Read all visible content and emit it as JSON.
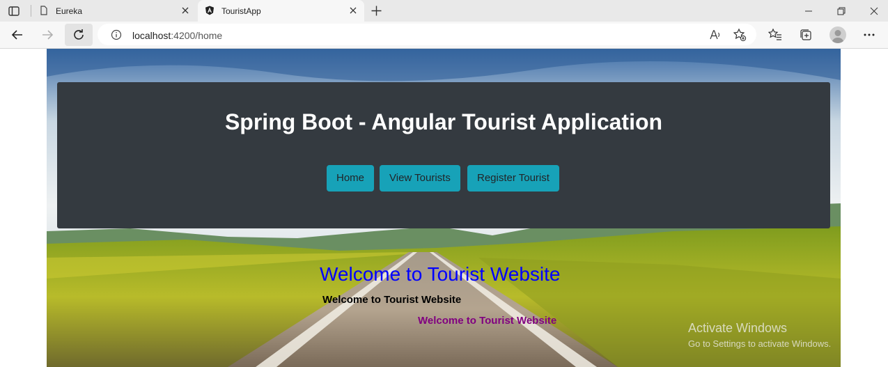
{
  "browser": {
    "tabs": [
      {
        "title": "Eureka",
        "icon": "page-icon",
        "active": false
      },
      {
        "title": "TouristApp",
        "icon": "angular-icon",
        "active": true
      }
    ],
    "address": {
      "host": "localhost",
      "path": ":4200/home"
    }
  },
  "header": {
    "title": "Spring Boot - Angular Tourist Application",
    "nav": [
      {
        "label": "Home"
      },
      {
        "label": "View Tourists"
      },
      {
        "label": "Register Tourist"
      }
    ],
    "nav_color": "#17a2b8",
    "card_color": "#343a40"
  },
  "main": {
    "welcome_heading": "Welcome to Tourist Website",
    "welcome_bold": "Welcome to Tourist Website",
    "welcome_purple": "Welcome to Tourist Website"
  },
  "watermark": {
    "line1": "Activate Windows",
    "line2": "Go to Settings to activate Windows."
  }
}
